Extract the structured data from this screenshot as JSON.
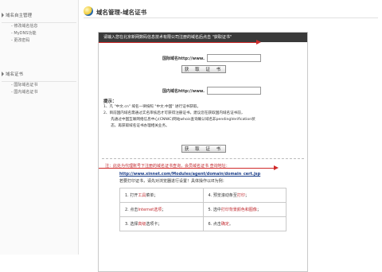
{
  "sidebar": {
    "group1": "域名自主管理",
    "items1": [
      "修改域名信息",
      "MyDNS功能",
      "更改密码"
    ],
    "group2": "域名证书",
    "items2": [
      "国际域名证书",
      "国内域名证书"
    ]
  },
  "header": {
    "title": "域名管理-域名证书"
  },
  "panel": {
    "banner": "请输入您在北京新网数码信息技术有限公司注册的域名后点击 \"获取证书\"",
    "intl_label": "国际域名http://www.",
    "intl_value": "",
    "get_cert": "获 取 证 书",
    "cn_label": "国内域名http://www.",
    "cn_value": "",
    "tips_title": "提示：",
    "tips": [
      "1、凡 \"中文.cn\" 域名一律按照 \"中文.中国\" 进行证书获取。",
      "2、目前国内域名需通过实名审核后才可获得注册证书，建议您在获取国内域名证书前，",
      "　　先通过中国互联网络信息中心(CNNIC)网站whois查询确认域名非pendingVerification状",
      "　　态，再获取域名证书办理相关业务。"
    ],
    "notice": "注：此处为代理账号下注册的域名证书查询，会员域名证书 查询地址：",
    "url": "http://www.xinnet.com/Modules/agent/domain/domain_cert.jsp",
    "print_note": "若要打印证书，请先对浏览器进行设置！具体操作以IE为例：",
    "steps": [
      {
        "num": "1.",
        "pre": "打开",
        "hl": "工具",
        "post": "菜单；"
      },
      {
        "num": "4.",
        "pre": "预览滚动条至",
        "hl": "打印",
        "post": "；"
      },
      {
        "num": "2.",
        "pre": "点击",
        "hl": "Internet选项",
        "post": "；"
      },
      {
        "num": "5.",
        "pre": "选中",
        "hl": "打印背景颜色和图像",
        "post": "；"
      },
      {
        "num": "3.",
        "pre": "选择",
        "hl": "高级",
        "post": "选项卡；"
      },
      {
        "num": "6.",
        "pre": "点击",
        "hl": "确定",
        "post": "。"
      }
    ]
  }
}
